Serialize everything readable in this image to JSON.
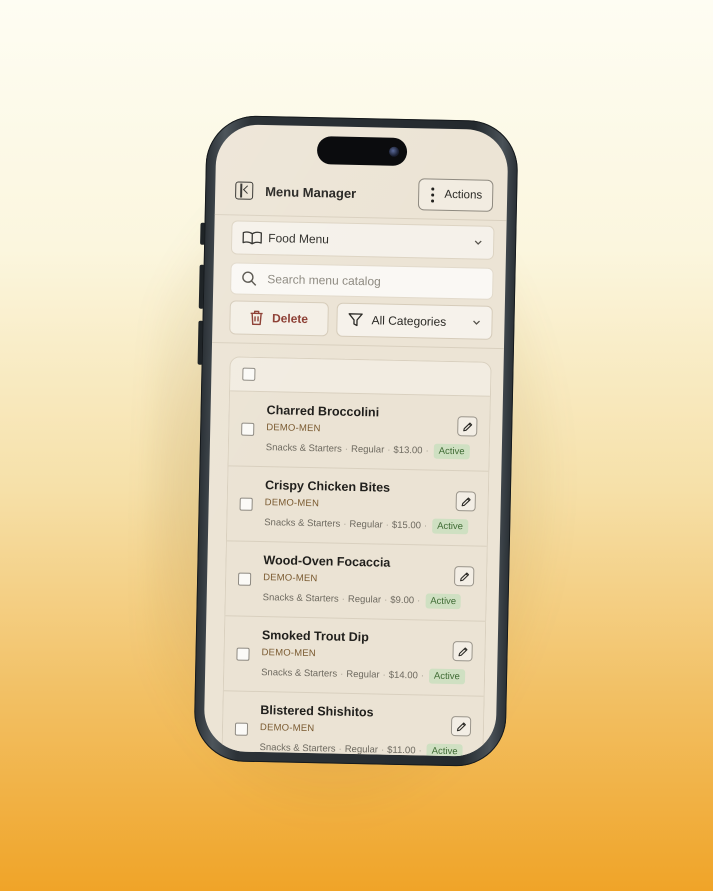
{
  "header": {
    "title": "Menu Manager",
    "actions_label": "Actions"
  },
  "menu_select": {
    "value": "Food Menu"
  },
  "search": {
    "placeholder": "Search menu catalog"
  },
  "toolbar": {
    "delete_label": "Delete",
    "category_value": "All Categories"
  },
  "items": [
    {
      "name": "Charred Broccolini",
      "code": "DEMO-MEN",
      "category": "Snacks & Starters",
      "size": "Regular",
      "price": "$13.00",
      "status": "Active"
    },
    {
      "name": "Crispy Chicken Bites",
      "code": "DEMO-MEN",
      "category": "Snacks & Starters",
      "size": "Regular",
      "price": "$15.00",
      "status": "Active"
    },
    {
      "name": "Wood-Oven Focaccia",
      "code": "DEMO-MEN",
      "category": "Snacks & Starters",
      "size": "Regular",
      "price": "$9.00",
      "status": "Active"
    },
    {
      "name": "Smoked Trout Dip",
      "code": "DEMO-MEN",
      "category": "Snacks & Starters",
      "size": "Regular",
      "price": "$14.00",
      "status": "Active"
    },
    {
      "name": "Blistered Shishitos",
      "code": "DEMO-MEN",
      "category": "Snacks & Starters",
      "size": "Regular",
      "price": "$11.00",
      "status": "Active"
    }
  ],
  "colors": {
    "accent_delete": "#8a3a2f",
    "status_active_bg": "#cfe0c2",
    "status_active_text": "#3f6b34",
    "screen_bg": "#ece4d5"
  }
}
